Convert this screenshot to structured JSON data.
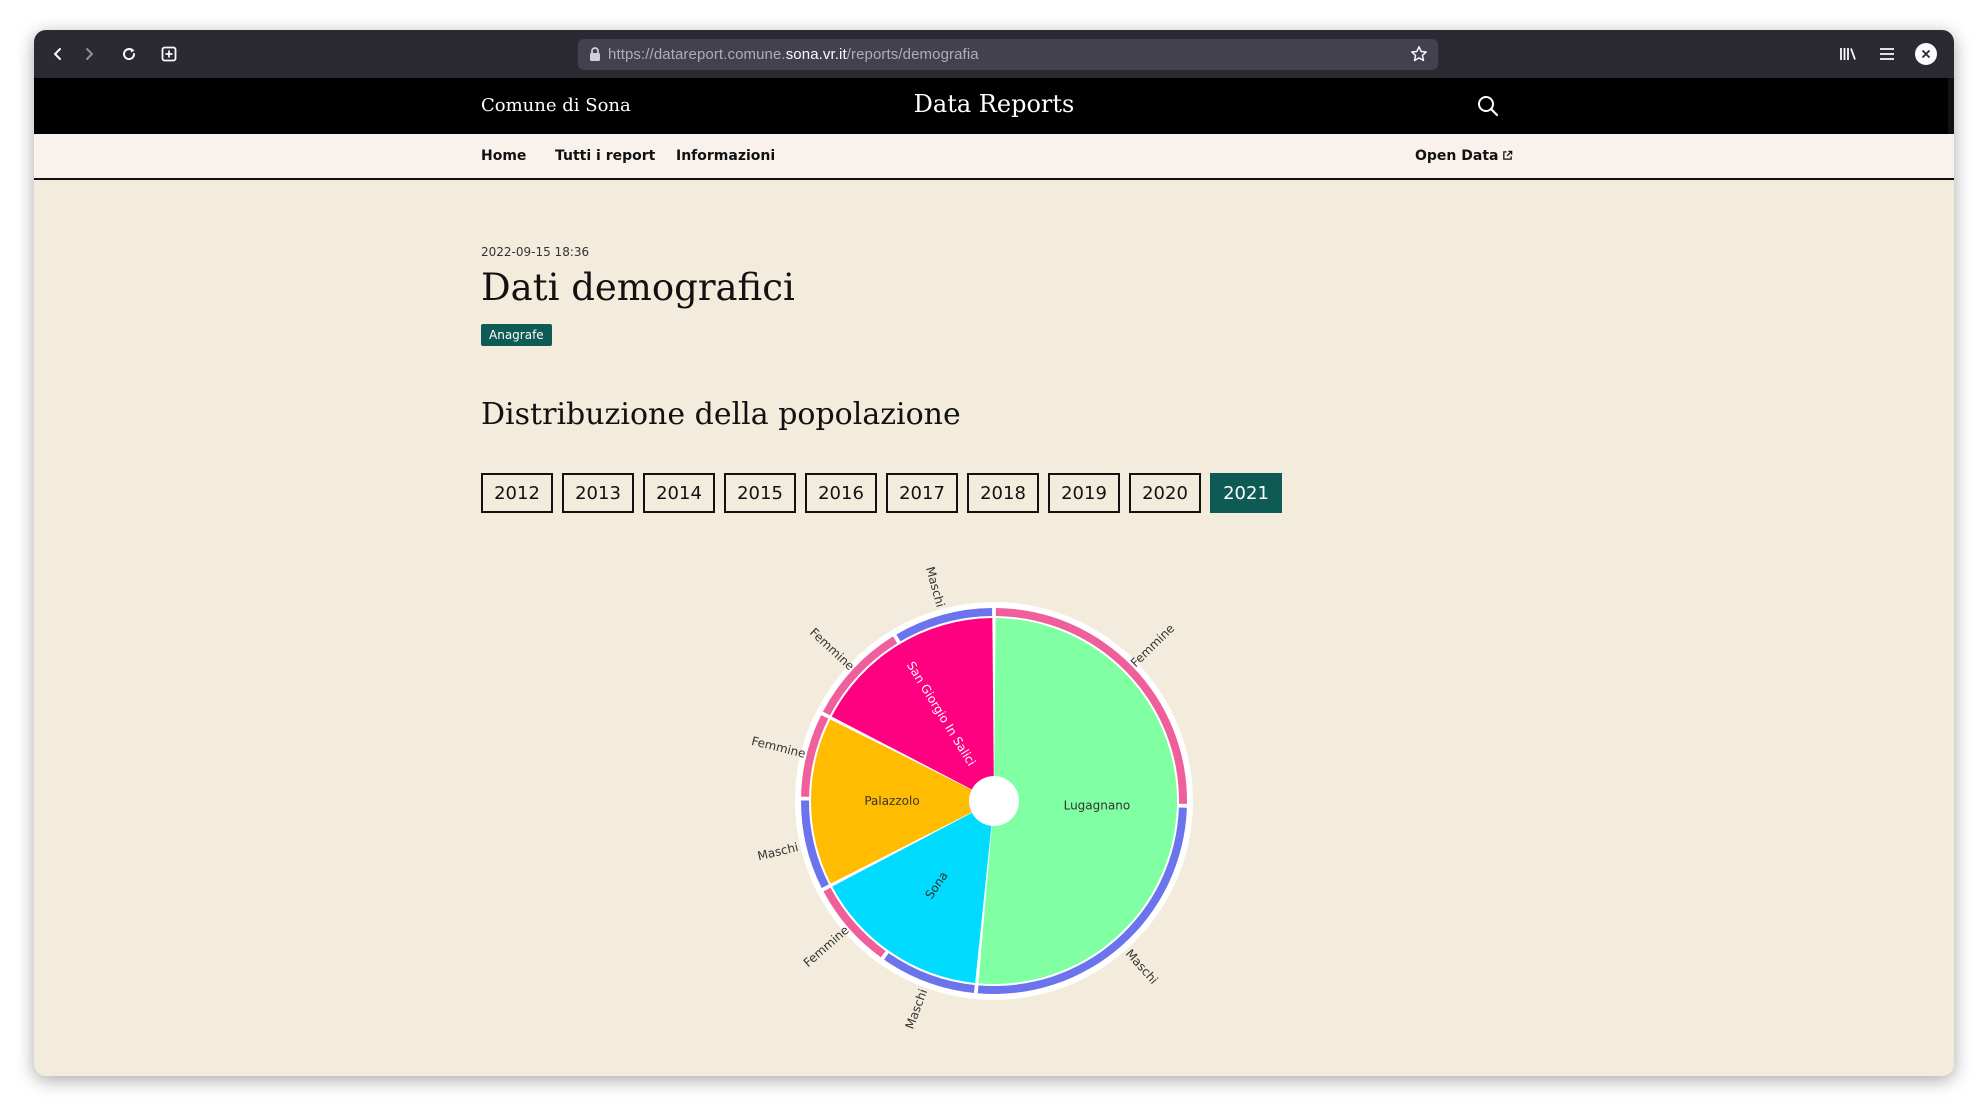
{
  "browser": {
    "url_prefix": "https://datareport.comune.",
    "url_domain": "sona.vr.it",
    "url_path": "/reports/demografia"
  },
  "header": {
    "site_name": "Comune di Sona",
    "title": "Data Reports"
  },
  "nav": {
    "home": "Home",
    "all_reports": "Tutti i report",
    "info": "Informazioni",
    "open_data": "Open Data"
  },
  "report": {
    "timestamp": "2022-09-15 18:36",
    "title": "Dati demografici",
    "tag": "Anagrafe",
    "section_title": "Distribuzione della popolazione"
  },
  "years": [
    "2012",
    "2013",
    "2014",
    "2015",
    "2016",
    "2017",
    "2018",
    "2019",
    "2020",
    "2021"
  ],
  "selected_year": "2021",
  "colors": {
    "accent": "#0e5a55",
    "femmine": "#ef5f9b",
    "maschi": "#6b74ec"
  },
  "chart_data": {
    "type": "sunburst",
    "title": "",
    "inner_ring": [
      {
        "name": "Lugagnano",
        "share": 0.515,
        "color": "#80ffa3"
      },
      {
        "name": "Sona",
        "share": 0.159,
        "color": "#00dbff"
      },
      {
        "name": "Palazzolo",
        "share": 0.151,
        "color": "#ffbc00"
      },
      {
        "name": "San Giorgio In Salici",
        "share": 0.175,
        "color": "#ff0080"
      }
    ],
    "outer_ring": [
      {
        "parent": "Lugagnano",
        "name": "Femmine",
        "share": 0.254
      },
      {
        "parent": "Lugagnano",
        "name": "Maschi",
        "share": 0.261
      },
      {
        "parent": "Sona",
        "name": "Maschi",
        "share": 0.083
      },
      {
        "parent": "Sona",
        "name": "Femmine",
        "share": 0.076
      },
      {
        "parent": "Palazzolo",
        "name": "Maschi",
        "share": 0.078
      },
      {
        "parent": "Palazzolo",
        "name": "Femmine",
        "share": 0.073
      },
      {
        "parent": "San Giorgio In Salici",
        "name": "Femmine",
        "share": 0.089
      },
      {
        "parent": "San Giorgio In Salici",
        "name": "Maschi",
        "share": 0.086
      }
    ]
  }
}
